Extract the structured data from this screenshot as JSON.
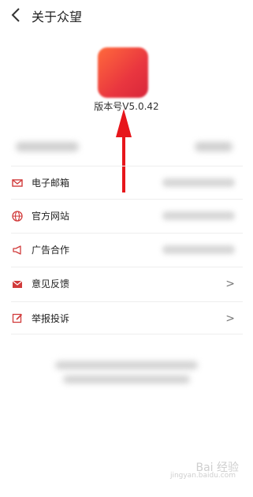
{
  "header": {
    "title": "关于众望",
    "back_icon": "back-chevron-icon"
  },
  "app": {
    "version_text": "版本号V5.0.42",
    "brand_color": "#e9363f"
  },
  "menu": {
    "items": [
      {
        "label": "电子邮箱",
        "icon": "mail-icon"
      },
      {
        "label": "官方网站",
        "icon": "globe-icon"
      },
      {
        "label": "广告合作",
        "icon": "megaphone-icon"
      },
      {
        "label": "意见反馈",
        "icon": "feedback-icon",
        "chevron": ">"
      },
      {
        "label": "举报投诉",
        "icon": "report-icon",
        "chevron": ">"
      }
    ]
  },
  "watermark": {
    "text": "Bai 经验",
    "sub": "jingyan.baidu.com"
  }
}
